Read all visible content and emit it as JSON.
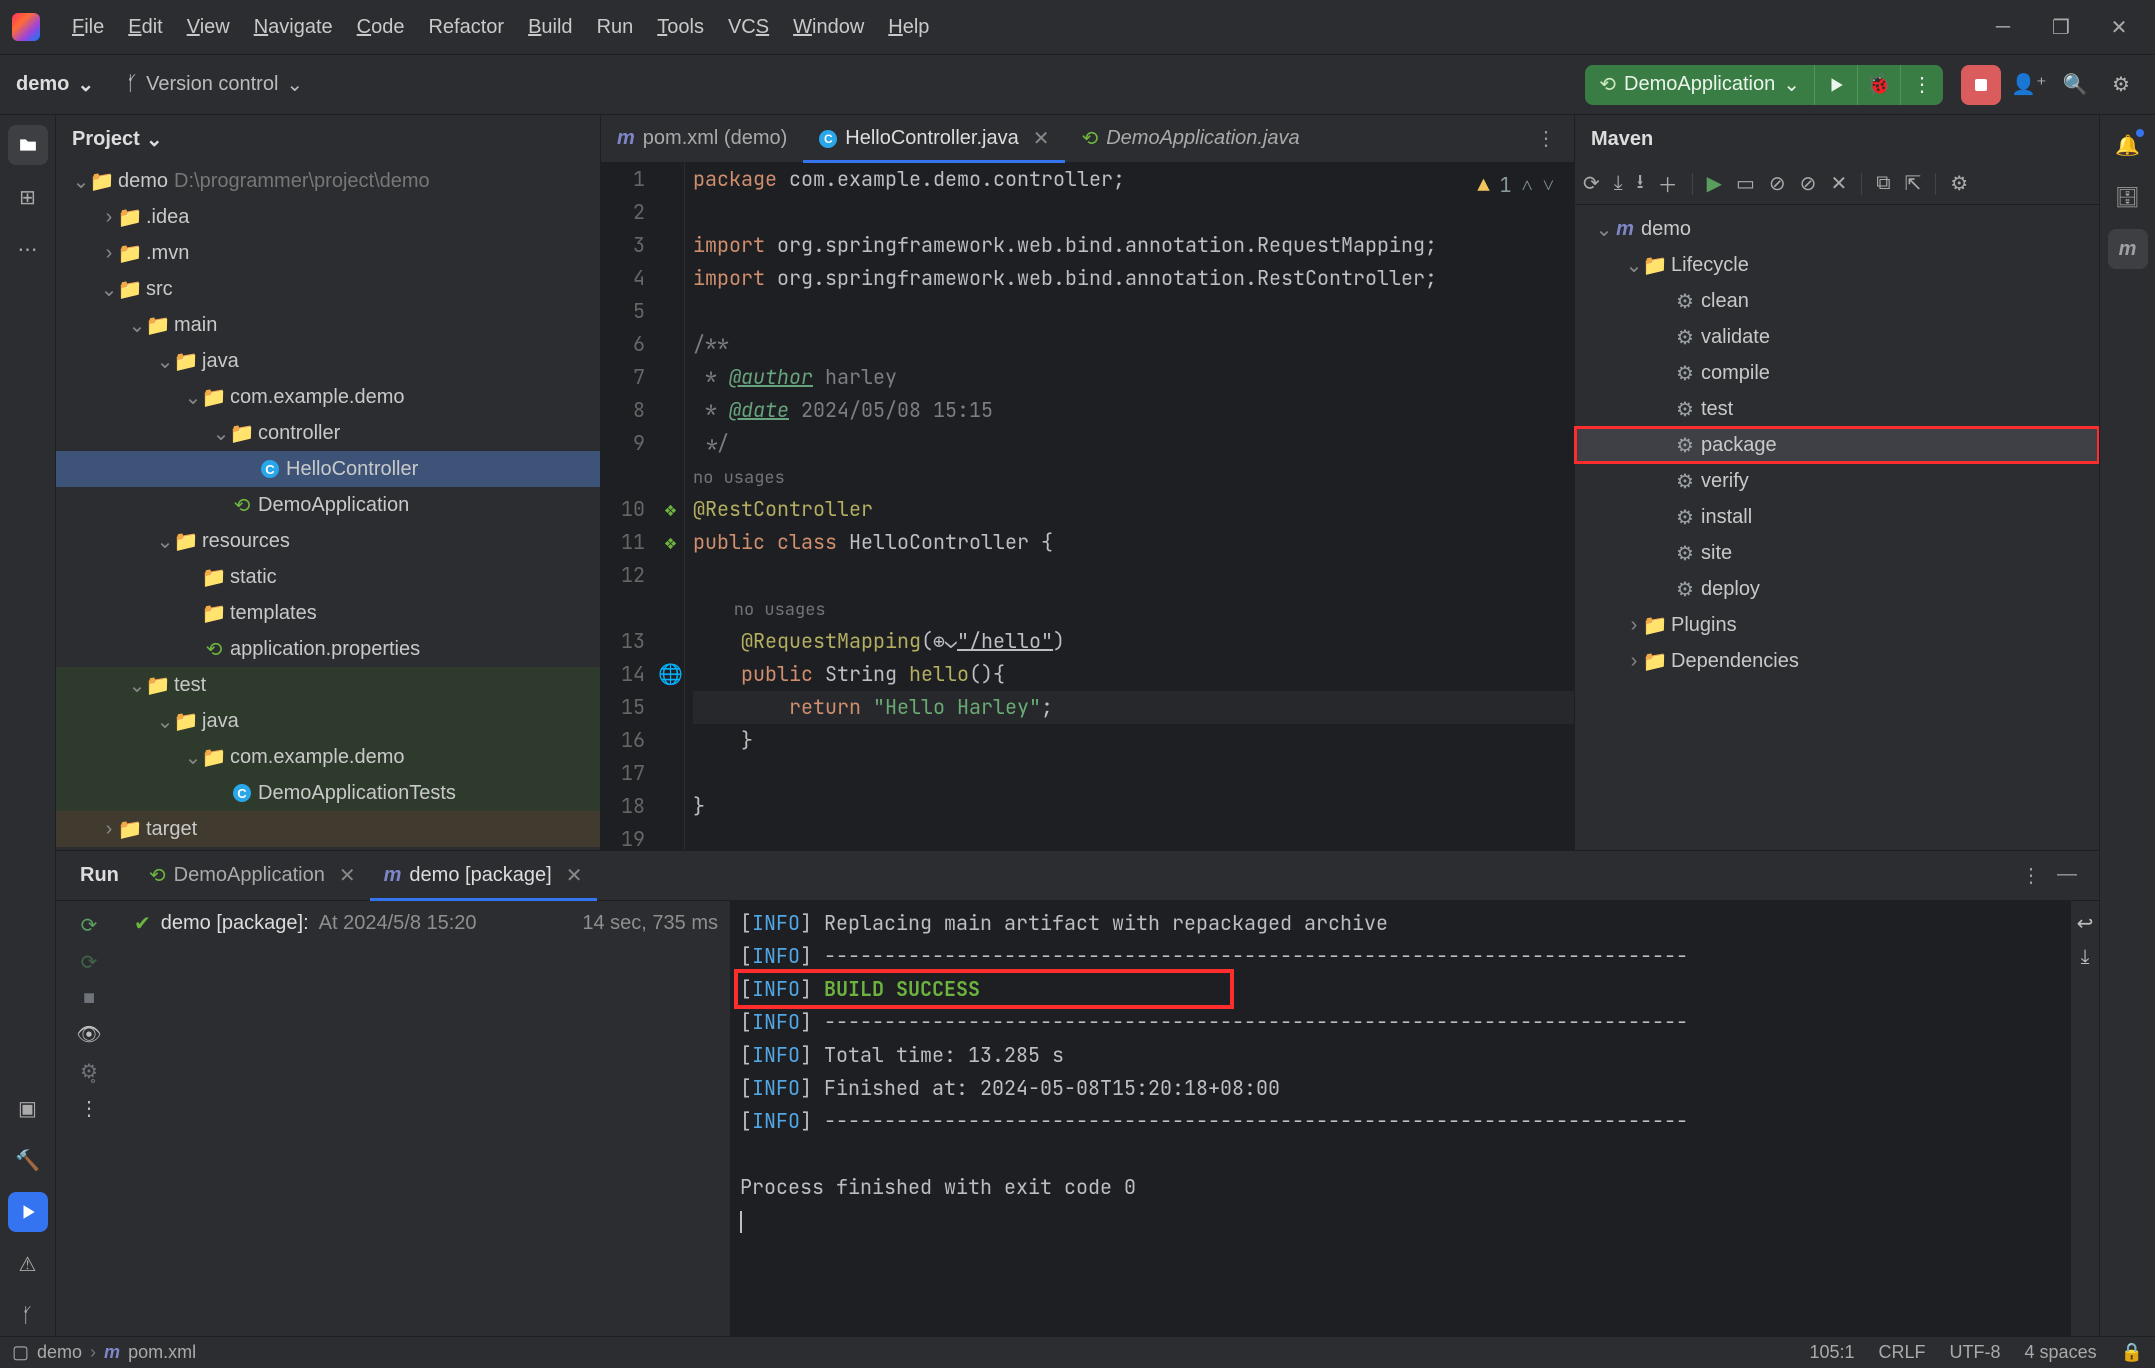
{
  "menu": [
    "File",
    "Edit",
    "View",
    "Navigate",
    "Code",
    "Refactor",
    "Build",
    "Run",
    "Tools",
    "VCS",
    "Window",
    "Help"
  ],
  "menuUnderline": [
    0,
    0,
    0,
    0,
    0,
    -1,
    0,
    -1,
    0,
    2,
    0,
    0
  ],
  "toolbar": {
    "project": "demo",
    "vcs": "Version control",
    "runConfig": "DemoApplication"
  },
  "projectPane": {
    "title": "Project"
  },
  "projectTree": [
    {
      "d": 0,
      "tw": "v",
      "ic": "folder-blue",
      "label": "demo",
      "sub": "D:\\programmer\\project\\demo"
    },
    {
      "d": 1,
      "tw": ">",
      "ic": "folder-yellow",
      "label": ".idea"
    },
    {
      "d": 1,
      "tw": ">",
      "ic": "folder-gray",
      "label": ".mvn"
    },
    {
      "d": 1,
      "tw": "v",
      "ic": "folder-gray",
      "label": "src"
    },
    {
      "d": 2,
      "tw": "v",
      "ic": "folder-gray",
      "label": "main"
    },
    {
      "d": 3,
      "tw": "v",
      "ic": "folder-blue",
      "label": "java"
    },
    {
      "d": 4,
      "tw": "v",
      "ic": "folder-gray",
      "label": "com.example.demo"
    },
    {
      "d": 5,
      "tw": "v",
      "ic": "folder-gray",
      "label": "controller"
    },
    {
      "d": 6,
      "tw": "",
      "ic": "class-c",
      "label": "HelloController",
      "sel": true
    },
    {
      "d": 5,
      "tw": "",
      "ic": "spring",
      "label": "DemoApplication"
    },
    {
      "d": 3,
      "tw": "v",
      "ic": "folder-teal",
      "label": "resources"
    },
    {
      "d": 4,
      "tw": "",
      "ic": "folder-teal",
      "label": "static"
    },
    {
      "d": 4,
      "tw": "",
      "ic": "folder-teal",
      "label": "templates"
    },
    {
      "d": 4,
      "tw": "",
      "ic": "spring",
      "label": "application.properties"
    },
    {
      "d": 2,
      "tw": "v",
      "ic": "folder-gray",
      "label": "test",
      "hl": "green"
    },
    {
      "d": 3,
      "tw": "v",
      "ic": "folder-blue",
      "label": "java",
      "hl": "green"
    },
    {
      "d": 4,
      "tw": "v",
      "ic": "folder-gray",
      "label": "com.example.demo",
      "hl": "green"
    },
    {
      "d": 5,
      "tw": "",
      "ic": "class-c",
      "label": "DemoApplicationTests",
      "hl": "green"
    },
    {
      "d": 1,
      "tw": ">",
      "ic": "folder-yellow",
      "label": "target",
      "hl": "brown"
    }
  ],
  "editorTabs": [
    {
      "ic": "m",
      "label": "pom.xml (demo)",
      "active": false,
      "italic": false,
      "close": false
    },
    {
      "ic": "c",
      "label": "HelloController.java",
      "active": true,
      "italic": false,
      "close": true
    },
    {
      "ic": "s",
      "label": "DemoApplication.java",
      "active": false,
      "italic": true,
      "close": false
    }
  ],
  "editorWarn": {
    "count": "1"
  },
  "code": {
    "lines": [
      {
        "n": 1,
        "segs": [
          {
            "c": "kw",
            "t": "package "
          },
          {
            "c": "pkg",
            "t": "com.example.demo.controller;"
          }
        ]
      },
      {
        "n": 2,
        "segs": []
      },
      {
        "n": 3,
        "segs": [
          {
            "c": "kw",
            "t": "import "
          },
          {
            "c": "pkg",
            "t": "org.springframework.web.bind.annotation."
          },
          {
            "c": "pkg",
            "t": "RequestMapping"
          },
          {
            "c": "pkg",
            "t": ";"
          }
        ]
      },
      {
        "n": 4,
        "segs": [
          {
            "c": "kw",
            "t": "import "
          },
          {
            "c": "pkg",
            "t": "org.springframework.web.bind.annotation."
          },
          {
            "c": "pkg",
            "t": "RestController"
          },
          {
            "c": "pkg",
            "t": ";"
          }
        ]
      },
      {
        "n": 5,
        "segs": []
      },
      {
        "n": 6,
        "segs": [
          {
            "c": "cmt",
            "t": "/**"
          }
        ]
      },
      {
        "n": 7,
        "segs": [
          {
            "c": "cmt",
            "t": " * "
          },
          {
            "c": "cmt-tag",
            "t": "@author"
          },
          {
            "c": "cmt",
            "t": " harley"
          }
        ]
      },
      {
        "n": 8,
        "segs": [
          {
            "c": "cmt",
            "t": " * "
          },
          {
            "c": "cmt-tag",
            "t": "@date"
          },
          {
            "c": "cmt",
            "t": " 2024/05/08 15:15"
          }
        ]
      },
      {
        "n": 9,
        "segs": [
          {
            "c": "cmt",
            "t": " */"
          }
        ]
      },
      {
        "n": "",
        "hint": "no usages",
        "segs": []
      },
      {
        "n": 10,
        "gut": "leaf",
        "segs": [
          {
            "c": "ann",
            "t": "@RestController"
          }
        ]
      },
      {
        "n": 11,
        "gut": "leaf",
        "segs": [
          {
            "c": "kw",
            "t": "public class "
          },
          {
            "c": "pkg",
            "t": "HelloController {"
          }
        ]
      },
      {
        "n": 12,
        "segs": []
      },
      {
        "n": "",
        "hint": "    no usages",
        "segs": []
      },
      {
        "n": 13,
        "segs": [
          {
            "c": "",
            "t": "    "
          },
          {
            "c": "ann",
            "t": "@RequestMapping"
          },
          {
            "c": "pkg",
            "t": "(⊕⌄"
          },
          {
            "c": "link",
            "t": "\"/hello\""
          },
          {
            "c": "pkg",
            "t": ")"
          }
        ]
      },
      {
        "n": 14,
        "gut": "globe",
        "segs": [
          {
            "c": "",
            "t": "    "
          },
          {
            "c": "kw",
            "t": "public "
          },
          {
            "c": "pkg",
            "t": "String "
          },
          {
            "c": "ann",
            "t": "hello"
          },
          {
            "c": "pkg",
            "t": "(){"
          }
        ]
      },
      {
        "n": 15,
        "caret": true,
        "segs": [
          {
            "c": "",
            "t": "        "
          },
          {
            "c": "kw",
            "t": "return "
          },
          {
            "c": "str",
            "t": "\"Hello Harley\""
          },
          {
            "c": "pkg",
            "t": ";"
          }
        ]
      },
      {
        "n": 16,
        "segs": [
          {
            "c": "",
            "t": "    }"
          }
        ]
      },
      {
        "n": 17,
        "segs": []
      },
      {
        "n": 18,
        "segs": [
          {
            "c": "pkg",
            "t": "}"
          }
        ]
      },
      {
        "n": 19,
        "segs": []
      }
    ]
  },
  "maven": {
    "title": "Maven",
    "tree": [
      {
        "d": 0,
        "tw": "v",
        "ic": "m",
        "label": "demo"
      },
      {
        "d": 1,
        "tw": "v",
        "ic": "folder-blue",
        "label": "Lifecycle"
      },
      {
        "d": 2,
        "ic": "gear",
        "label": "clean"
      },
      {
        "d": 2,
        "ic": "gear",
        "label": "validate"
      },
      {
        "d": 2,
        "ic": "gear",
        "label": "compile"
      },
      {
        "d": 2,
        "ic": "gear",
        "label": "test"
      },
      {
        "d": 2,
        "ic": "gear",
        "label": "package",
        "hl": true,
        "boxed": true
      },
      {
        "d": 2,
        "ic": "gear",
        "label": "verify"
      },
      {
        "d": 2,
        "ic": "gear",
        "label": "install"
      },
      {
        "d": 2,
        "ic": "gear",
        "label": "site"
      },
      {
        "d": 2,
        "ic": "gear",
        "label": "deploy"
      },
      {
        "d": 1,
        "tw": ">",
        "ic": "folder-blue",
        "label": "Plugins"
      },
      {
        "d": 1,
        "tw": ">",
        "ic": "folder-blue",
        "label": "Dependencies"
      }
    ]
  },
  "runPanel": {
    "title": "Run",
    "tabs": [
      {
        "ic": "s",
        "label": "DemoApplication",
        "active": false
      },
      {
        "ic": "m",
        "label": "demo [package]",
        "active": true
      }
    ],
    "task": {
      "name": "demo [package]:",
      "sub": "At 2024/5/8 15:20",
      "time": "14 sec, 735 ms"
    },
    "console": [
      {
        "parts": [
          {
            "c": "",
            "t": "["
          },
          {
            "c": "info",
            "t": "INFO"
          },
          {
            "c": "",
            "t": "] Replacing main artifact with repackaged archive"
          }
        ]
      },
      {
        "parts": [
          {
            "c": "",
            "t": "["
          },
          {
            "c": "info",
            "t": "INFO"
          },
          {
            "c": "",
            "t": "] ------------------------------------------------------------------------"
          }
        ]
      },
      {
        "parts": [
          {
            "c": "",
            "t": "["
          },
          {
            "c": "info",
            "t": "INFO"
          },
          {
            "c": "",
            "t": "] "
          },
          {
            "c": "ok",
            "t": "BUILD SUCCESS"
          }
        ]
      },
      {
        "parts": [
          {
            "c": "",
            "t": "["
          },
          {
            "c": "info",
            "t": "INFO"
          },
          {
            "c": "",
            "t": "] ------------------------------------------------------------------------"
          }
        ]
      },
      {
        "parts": [
          {
            "c": "",
            "t": "["
          },
          {
            "c": "info",
            "t": "INFO"
          },
          {
            "c": "",
            "t": "] Total time:  13.285 s"
          }
        ]
      },
      {
        "parts": [
          {
            "c": "",
            "t": "["
          },
          {
            "c": "info",
            "t": "INFO"
          },
          {
            "c": "",
            "t": "] Finished at: 2024-05-08T15:20:18+08:00"
          }
        ]
      },
      {
        "parts": [
          {
            "c": "",
            "t": "["
          },
          {
            "c": "info",
            "t": "INFO"
          },
          {
            "c": "",
            "t": "] ------------------------------------------------------------------------"
          }
        ]
      },
      {
        "parts": [
          {
            "c": "",
            "t": ""
          }
        ]
      },
      {
        "parts": [
          {
            "c": "",
            "t": "Process finished with exit code 0"
          }
        ]
      },
      {
        "parts": [
          {
            "c": "",
            "t": ""
          }
        ],
        "caret": true
      }
    ]
  },
  "status": {
    "crumbs": [
      {
        "ic": "sq",
        "t": "demo"
      },
      {
        "ic": "m",
        "t": "pom.xml"
      }
    ],
    "pos": "105:1",
    "eol": "CRLF",
    "enc": "UTF-8",
    "indent": "4 spaces"
  }
}
